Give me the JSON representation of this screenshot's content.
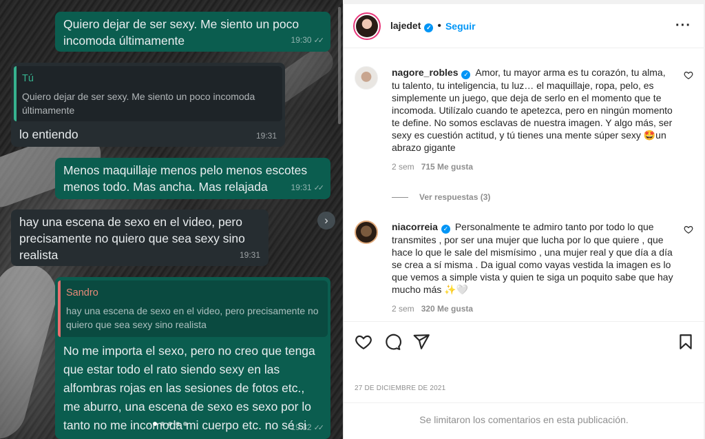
{
  "chat": {
    "messages": [
      {
        "type": "outgoing",
        "text": "Quiero dejar de ser sexy. Me siento un poco incomoda últimamente",
        "time": "19:30"
      },
      {
        "type": "incoming",
        "quote_author": "Tú",
        "quote_text": "Quiero dejar de ser sexy. Me siento un poco incomoda últimamente",
        "text": "lo entiendo",
        "time": "19:31"
      },
      {
        "type": "outgoing",
        "text": "Menos maquillaje menos pelo menos escotes menos todo. Mas ancha. Mas relajada",
        "time": "19:31"
      },
      {
        "type": "incoming",
        "text": "hay una escena de sexo en el video, pero precisamente no quiero que sea sexy sino realista",
        "time": "19:31"
      },
      {
        "type": "outgoing",
        "quote_author": "Sandro",
        "quote_text": "hay una escena de sexo en el video, pero precisamente no quiero que sea sexy sino realista",
        "text": "No me importa el sexo, pero no creo que tenga que estar todo el rato siendo sexy en las alfombras rojas en las sesiones de fotos etc., me aburro, una escena de sexo es sexo por lo tanto no me incomoda mi cuerpo etc. no sé si me explico",
        "time": "19:32"
      }
    ],
    "forward_icon": "chevron-right-icon",
    "carousel": {
      "count": 5,
      "active": 1
    }
  },
  "post": {
    "username": "lajedet",
    "follow_label": "Seguir",
    "more_icon": "more-horizontal-icon",
    "comments": [
      {
        "username": "nagore_robles",
        "text": "Amor, tu mayor arma es tu corazón, tu alma, tu talento, tu inteligencia, tu luz… el maquillaje, ropa, pelo, es simplemente un juego, que deja de serlo en el momento que te incomoda. Utilízalo cuando te apetezca, pero en ningún momento te define. No somos esclavas de nuestra imagen. Y algo más, ser sexy es cuestión actitud, y tú tienes una mente súper sexy 🤩un abrazo gigante",
        "age": "2 sem",
        "likes": "715 Me gusta"
      },
      {
        "username": "niacorreia",
        "text": "Personalmente te admiro tanto por todo lo que transmites , por ser una mujer que lucha por lo que quiere , que hace lo que le sale del mismísimo , una mujer real y que día a día se crea a sí misma . Da igual como vayas vestida la imagen es lo que vemos a simple vista y quien te siga un poquito sabe que hay mucho más ✨🤍",
        "age": "2 sem",
        "likes": "320 Me gusta"
      }
    ],
    "view_replies": "Ver respuestas (3)",
    "date": "27 DE DICIEMBRE DE 2021",
    "comments_limited": "Se limitaron los comentarios en esta publicación.",
    "colors": {
      "accent": "#0095f6",
      "out_bubble": "#0b5d4f",
      "in_bubble": "#262d31"
    }
  }
}
